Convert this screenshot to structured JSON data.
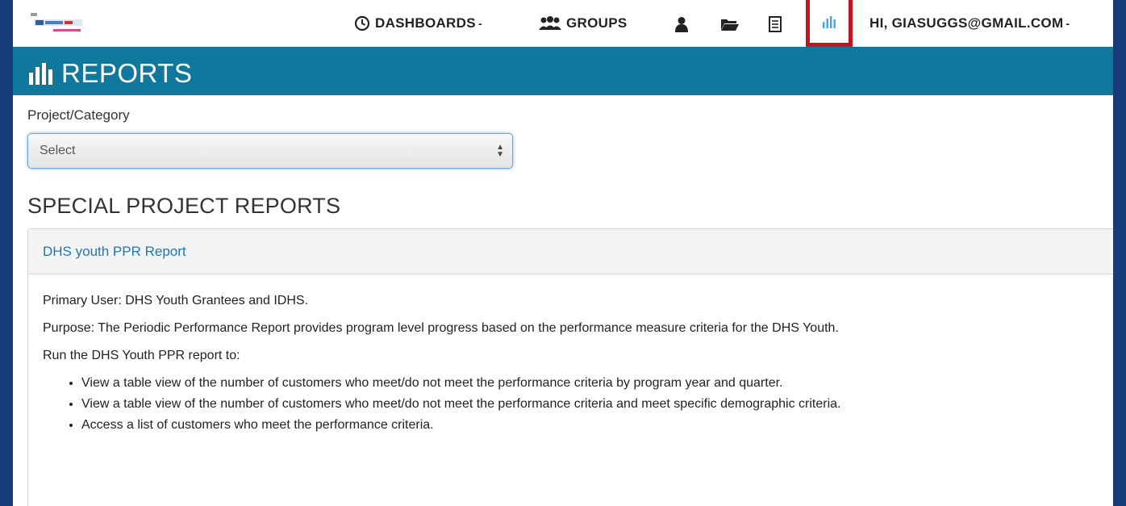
{
  "nav": {
    "dashboards_label": "DASHBOARDS",
    "dashboards_caret": "-",
    "groups_label": "GROUPS",
    "user_greeting": "HI, GIASUGGS@GMAIL.COM",
    "user_caret": "-",
    "icons": [
      "clock-icon",
      "users-icon",
      "user-icon",
      "folder-icon",
      "document-icon",
      "reports-chart-icon"
    ]
  },
  "header": {
    "title": "REPORTS"
  },
  "filter": {
    "label": "Project/Category",
    "selected": "Select"
  },
  "section": {
    "title": "SPECIAL PROJECT REPORTS"
  },
  "report": {
    "title": "DHS youth PPR Report",
    "primary_user": "Primary User: DHS Youth Grantees and IDHS.",
    "purpose": "Purpose: The Periodic Performance Report provides program level progress based on the performance measure criteria for the DHS Youth.",
    "run_intro": "Run the DHS Youth PPR report to:",
    "bullets": [
      "View a table view of the number of customers who meet/do not meet the performance criteria by program year and quarter.",
      "View a table view of the number of customers who meet/do not meet the performance criteria and meet specific demographic criteria.",
      "Access a list of customers who meet the performance criteria."
    ]
  },
  "colors": {
    "header_band": "#10779d",
    "highlight_border": "#c4151c",
    "link": "#1f77b4",
    "outer_background": "#173a78"
  }
}
